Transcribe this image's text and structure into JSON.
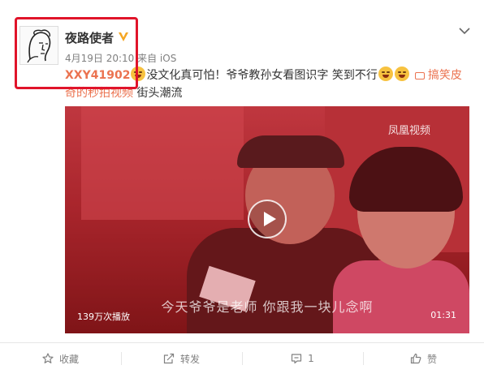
{
  "header": {
    "username": "夜路使者",
    "meta": "4月19日 20:10 来自 iOS",
    "verified_badge": "yellow-v"
  },
  "post": {
    "mention": "XXY41902",
    "line1_text": "没文化真可怕！爷爷教孙女看图识字 笑到不行",
    "line1_link": "搞笑皮",
    "line2_link": "奇的秒拍视频",
    "line2_text": " 街头潮流"
  },
  "video": {
    "watermark": "凤凰视频",
    "subtitle": "今天爷爷是老师 你跟我一块儿念啊",
    "plays": "139万次播放",
    "duration": "01:31"
  },
  "actions": {
    "favorite": "收藏",
    "repost": "转发",
    "comment": "1",
    "like": "赞"
  },
  "colors": {
    "accent": "#eb7350",
    "highlight_box": "#e0142a",
    "verified": "#f5a623"
  },
  "icons": [
    "chevron-down-icon",
    "star-icon",
    "repost-icon",
    "comment-icon",
    "thumbs-up-icon",
    "play-icon",
    "video-link-icon"
  ]
}
